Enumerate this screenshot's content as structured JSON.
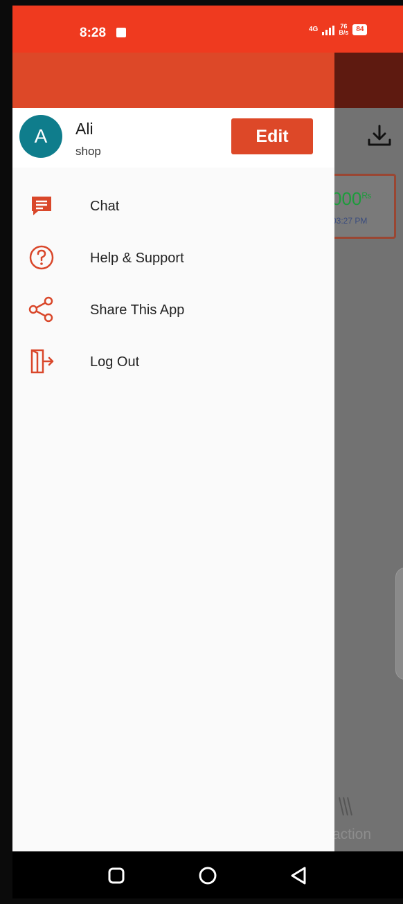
{
  "status_bar": {
    "time": "8:28",
    "network": "4G",
    "speed_value": "76",
    "speed_unit": "B/s",
    "battery": "84"
  },
  "background_screen": {
    "amount": "000",
    "amount_suffix": "₨",
    "time": "03:27 PM",
    "tab_label": "action"
  },
  "drawer": {
    "avatar_letter": "A",
    "user_name": "Ali",
    "user_role": "shop",
    "edit_label": "Edit",
    "menu": [
      {
        "label": "Chat",
        "icon": "chat-icon"
      },
      {
        "label": "Help & Support",
        "icon": "help-icon"
      },
      {
        "label": "Share This App",
        "icon": "share-icon"
      },
      {
        "label": "Log Out",
        "icon": "logout-icon"
      }
    ]
  },
  "nav_bar": {
    "buttons": [
      "recent-apps",
      "home",
      "back"
    ]
  },
  "colors": {
    "status_bar": "#ef3a1f",
    "accent": "#dd4828",
    "avatar": "#0f7d8c",
    "icon": "#d9472a"
  }
}
